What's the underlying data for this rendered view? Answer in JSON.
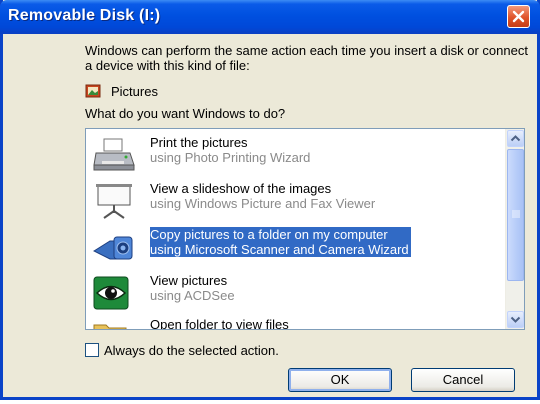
{
  "window": {
    "title": "Removable Disk (I:)"
  },
  "intro_text": "Windows can perform the same action each time you insert a disk or connect a device with this kind of file:",
  "content_type": {
    "icon": "pictures-icon",
    "label": "Pictures"
  },
  "question": "What do you want Windows to do?",
  "actions": [
    {
      "title": "Print the pictures",
      "subtitle": "using Photo Printing Wizard",
      "icon": "printer-icon",
      "selected": false
    },
    {
      "title": "View a slideshow of the images",
      "subtitle": "using Windows Picture and Fax Viewer",
      "icon": "projector-screen-icon",
      "selected": false
    },
    {
      "title": "Copy pictures to a folder on my computer",
      "subtitle": "using Microsoft Scanner and Camera Wizard",
      "icon": "camera-icon",
      "selected": true
    },
    {
      "title": "View pictures",
      "subtitle": "using ACDSee",
      "icon": "eye-icon",
      "selected": false
    },
    {
      "title": "Open folder to view files",
      "subtitle": "",
      "icon": "folder-icon",
      "selected": false
    }
  ],
  "always_checkbox": {
    "label": "Always do the selected action.",
    "checked": false
  },
  "buttons": {
    "ok": "OK",
    "cancel": "Cancel"
  },
  "colors": {
    "titlebar": "#0050e0",
    "selection": "#316ac5",
    "close": "#e0542a"
  }
}
